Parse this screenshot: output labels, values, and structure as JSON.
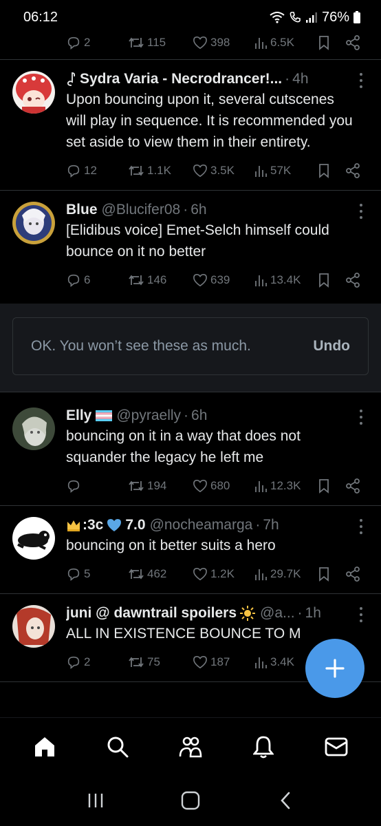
{
  "status_bar": {
    "time": "06:12",
    "battery": "76%"
  },
  "top_actions": {
    "reply": "2",
    "repost": "115",
    "like": "398",
    "views": "6.5K"
  },
  "tweets": [
    {
      "name": "Sydra Varia - Necrodrancer!...",
      "handle": "",
      "time": "4h",
      "text": "Upon bouncing upon it, several cutscenes will play in sequence. It is recommended you set aside to view them in their entirety.",
      "reply": "12",
      "repost": "1.1K",
      "like": "3.5K",
      "views": "57K"
    },
    {
      "name": "Blue",
      "handle": "@Blucifer08",
      "time": "6h",
      "text": "[Elidibus voice] Emet-Selch himself could bounce on it no better",
      "reply": "6",
      "repost": "146",
      "like": "639",
      "views": "13.4K"
    },
    {
      "name": "Elly",
      "handle": "@pyraelly",
      "time": "6h",
      "text": "bouncing on it in a way that does not squander the legacy he left me",
      "reply": "",
      "repost": "194",
      "like": "680",
      "views": "12.3K"
    },
    {
      "name": ":3c",
      "name2": "7.0",
      "handle": "@nocheamarga",
      "time": "7h",
      "text": "bouncing on it better suits a hero",
      "reply": "5",
      "repost": "462",
      "like": "1.2K",
      "views": "29.7K"
    },
    {
      "name": "juni @ dawntrail spoilers",
      "handle": "@a...",
      "time": "1h",
      "text": "ALL IN EXISTENCE BOUNCE TO M",
      "reply": "2",
      "repost": "75",
      "like": "187",
      "views": "3.4K"
    }
  ],
  "notice": {
    "text": "OK. You won’t see these as much.",
    "undo": "Undo"
  },
  "colors": {
    "accent": "#4a99e9",
    "muted": "#71767b",
    "background": "#000000"
  }
}
